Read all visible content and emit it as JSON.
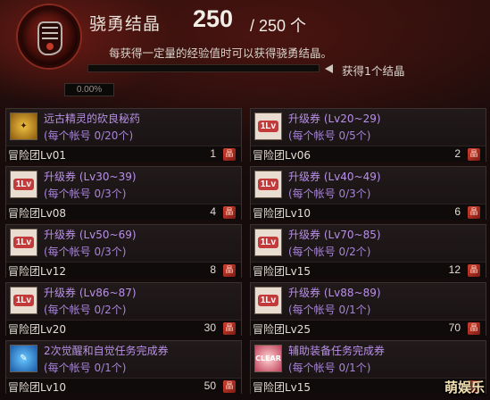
{
  "header": {
    "title": "骁勇结晶",
    "current": "250",
    "max": "/ 250 个",
    "description": "每获得一定量的经验值时可以获得骁勇结晶。",
    "progress_fraction": 0.0,
    "progress_label": "0.00%",
    "hint": "获得1个结晶",
    "emblem_icon": "fist-emblem-icon"
  },
  "items": [
    {
      "name": "远古精灵的砍良秘药",
      "limit": "(每个帐号 0/20个)",
      "req": "冒险团Lv01",
      "qty": "1",
      "icon": "gold"
    },
    {
      "name": "升级券 (Lv20~29)",
      "limit": "(每个帐号 0/5个)",
      "req": "冒险团Lv06",
      "qty": "2",
      "icon": "ticket"
    },
    {
      "name": "升级券 (Lv30~39)",
      "limit": "(每个帐号 0/3个)",
      "req": "冒险团Lv08",
      "qty": "4",
      "icon": "ticket"
    },
    {
      "name": "升级券 (Lv40~49)",
      "limit": "(每个帐号 0/3个)",
      "req": "冒险团Lv10",
      "qty": "6",
      "icon": "ticket"
    },
    {
      "name": "升级券 (Lv50~69)",
      "limit": "(每个帐号 0/3个)",
      "req": "冒险团Lv12",
      "qty": "8",
      "icon": "ticket"
    },
    {
      "name": "升级券 (Lv70~85)",
      "limit": "(每个帐号 0/2个)",
      "req": "冒险团Lv15",
      "qty": "12",
      "icon": "ticket"
    },
    {
      "name": "升级券 (Lv86~87)",
      "limit": "(每个帐号 0/2个)",
      "req": "冒险团Lv20",
      "qty": "30",
      "icon": "ticket"
    },
    {
      "name": "升级券 (Lv88~89)",
      "limit": "(每个帐号 0/1个)",
      "req": "冒险团Lv25",
      "qty": "70",
      "icon": "ticket"
    },
    {
      "name": "2次觉醒和自觉任务完成券",
      "limit": "(每个帐号 0/1个)",
      "req": "冒险团Lv10",
      "qty": "50",
      "icon": "blue"
    },
    {
      "name": "辅助装备任务完成券",
      "limit": "(每个帐号 0/1个)",
      "req": "冒险团Lv15",
      "qty": "",
      "icon": "clear"
    }
  ],
  "ticket_badge": "1Lv",
  "clear_badge": "CLEAR",
  "currency_glyph": "晶",
  "watermark": "萌娱乐"
}
